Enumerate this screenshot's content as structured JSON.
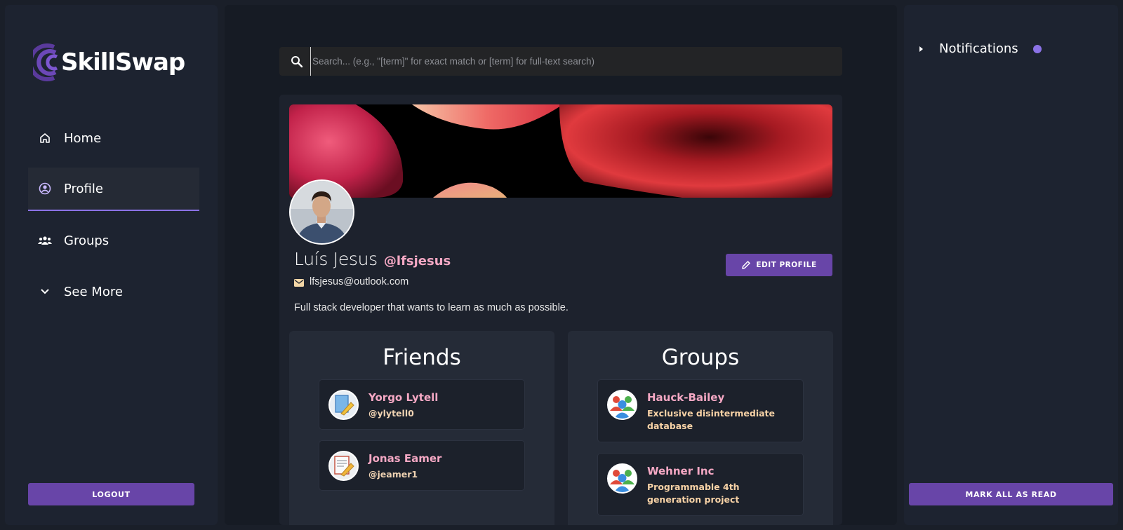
{
  "app": {
    "name": "SkillSwap",
    "accent": "#6845a8",
    "highlight": "#8b72e6"
  },
  "sidebar": {
    "items": [
      {
        "label": "Home",
        "icon": "home-icon",
        "active": false
      },
      {
        "label": "Profile",
        "icon": "user-circle-icon",
        "active": true
      },
      {
        "label": "Groups",
        "icon": "groups-icon",
        "active": false
      },
      {
        "label": "See More",
        "icon": "chevron-down-icon",
        "active": false
      }
    ],
    "logout_label": "LOGOUT"
  },
  "search": {
    "placeholder": "Search... (e.g., \"[term]\" for exact match or [term] for full-text search)",
    "icon": "search-icon"
  },
  "profile": {
    "name": "Luís Jesus",
    "username": "@lfsjesus",
    "email": "lfsjesus@outlook.com",
    "bio": "Full stack developer that wants to learn as much as possible.",
    "edit_label": "EDIT PROFILE"
  },
  "friends": {
    "title": "Friends",
    "items": [
      {
        "name": "Yorgo Lytell",
        "handle": "@ylytell0"
      },
      {
        "name": "Jonas Eamer",
        "handle": "@jeamer1"
      }
    ]
  },
  "groups": {
    "title": "Groups",
    "items": [
      {
        "name": "Hauck-Bailey",
        "description": "Exclusive disintermediate database"
      },
      {
        "name": "Wehner Inc",
        "description": "Programmable 4th generation project"
      }
    ]
  },
  "notifications": {
    "title": "Notifications",
    "mark_all_label": "MARK ALL AS READ",
    "has_unread": true
  }
}
